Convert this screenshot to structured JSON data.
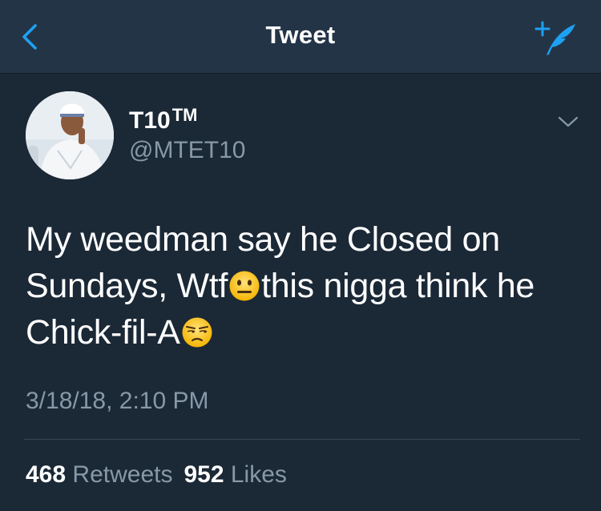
{
  "nav": {
    "title": "Tweet",
    "back_icon": "chevron-left-icon",
    "compose_icon": "compose-tweet-icon",
    "accent_color": "#1da1f2"
  },
  "tweet": {
    "author_name": "T10",
    "author_badge": "TM",
    "author_handle": "@MTET10",
    "text_part1": "My weedman say he Closed on Sundays, Wtf",
    "emoji1": "neutral-face-emoji",
    "text_part2": "this nigga think he Chick-fil-A",
    "emoji2": "unamused-face-emoji",
    "timestamp": "3/18/18, 2:10 PM",
    "retweets_count": "468",
    "retweets_label": "Retweets",
    "likes_count": "952",
    "likes_label": "Likes"
  },
  "colors": {
    "background": "#1b2836",
    "nav_background": "#243447",
    "secondary_text": "#8899a6"
  }
}
